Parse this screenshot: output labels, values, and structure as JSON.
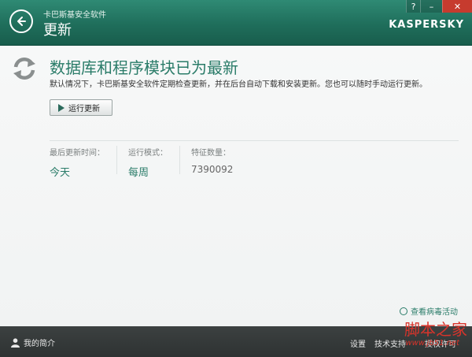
{
  "window": {
    "app_name": "卡巴斯基安全软件",
    "title": "更新",
    "brand": "KASPERSKY",
    "help_label": "?",
    "minimize_label": "–",
    "close_label": "✕"
  },
  "main": {
    "headline": "数据库和程序模块已为最新",
    "description": "默认情况下，卡巴斯基安全软件定期检查更新，并在后台自动下载和安装更新。您也可以随时手动运行更新。",
    "run_update_label": "运行更新"
  },
  "stats": [
    {
      "label": "最后更新时间：",
      "value": "今天"
    },
    {
      "label": "运行模式：",
      "value": "每周"
    },
    {
      "label": "特征数量：",
      "value": "7390092"
    }
  ],
  "virus_activity_link": "查看病毒活动",
  "footer": {
    "profile_label": "我的简介",
    "settings_label": "设置",
    "support_label": "技术支持",
    "license_label": "授权许可"
  },
  "watermark": {
    "text": "脚本之家",
    "url": "www.jb51.net"
  },
  "colors": {
    "accent": "#2a7c69",
    "titlebar": "#1f6e5b",
    "close": "#c63b2e",
    "footer": "#353939"
  }
}
